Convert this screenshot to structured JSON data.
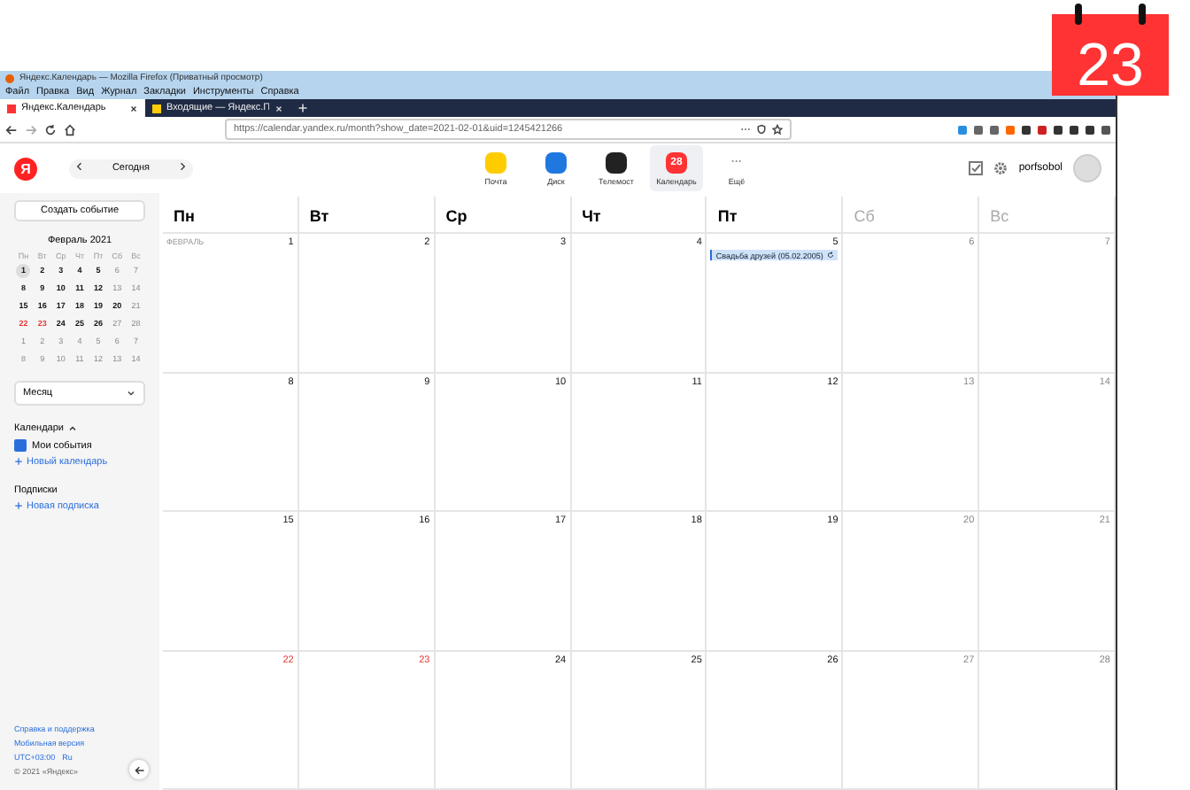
{
  "badge_day": "23",
  "browser": {
    "title": "Яндекс.Календарь — Mozilla Firefox (Приватный просмотр)",
    "menu": [
      "Файл",
      "Правка",
      "Вид",
      "Журнал",
      "Закладки",
      "Инструменты",
      "Справка"
    ],
    "tabs": [
      {
        "label": "Яндекс.Календарь",
        "selected": true
      },
      {
        "label": "Входящие — Яндекс.П",
        "selected": false
      }
    ],
    "url": "https://calendar.yandex.ru/month?show_date=2021-02-01&uid=1245421266"
  },
  "header": {
    "logo": "Я",
    "today_button": "Сегодня",
    "services": [
      {
        "label": "Почта",
        "kind": "mail",
        "selected": false
      },
      {
        "label": "Диск",
        "kind": "disk",
        "selected": false
      },
      {
        "label": "Телемост",
        "kind": "telemost",
        "selected": false
      },
      {
        "label": "Календарь",
        "kind": "calendar",
        "icon_text": "28",
        "selected": true
      },
      {
        "label": "Ещё",
        "kind": "more",
        "icon_text": "···",
        "selected": false
      }
    ],
    "user": "porfsobol"
  },
  "sidebar": {
    "create_button": "Создать событие",
    "mini_calendar": {
      "title": "Февраль 2021",
      "weekdays": [
        "Пн",
        "Вт",
        "Ср",
        "Чт",
        "Пт",
        "Сб",
        "Вс"
      ],
      "weeks": [
        [
          {
            "day": "1",
            "kind": "normal",
            "selected": true
          },
          {
            "day": "2",
            "kind": "normal",
            "selected": false
          },
          {
            "day": "3",
            "kind": "normal",
            "selected": false
          },
          {
            "day": "4",
            "kind": "normal",
            "selected": false
          },
          {
            "day": "5",
            "kind": "normal",
            "selected": false
          },
          {
            "day": "6",
            "kind": "weekend",
            "selected": false
          },
          {
            "day": "7",
            "kind": "weekend",
            "selected": false
          }
        ],
        [
          {
            "day": "8",
            "kind": "normal",
            "selected": false
          },
          {
            "day": "9",
            "kind": "normal",
            "selected": false
          },
          {
            "day": "10",
            "kind": "normal",
            "selected": false
          },
          {
            "day": "11",
            "kind": "normal",
            "selected": false
          },
          {
            "day": "12",
            "kind": "normal",
            "selected": false
          },
          {
            "day": "13",
            "kind": "weekend",
            "selected": false
          },
          {
            "day": "14",
            "kind": "weekend",
            "selected": false
          }
        ],
        [
          {
            "day": "15",
            "kind": "normal",
            "selected": false
          },
          {
            "day": "16",
            "kind": "normal",
            "selected": false
          },
          {
            "day": "17",
            "kind": "normal",
            "selected": false
          },
          {
            "day": "18",
            "kind": "normal",
            "selected": false
          },
          {
            "day": "19",
            "kind": "normal",
            "selected": false
          },
          {
            "day": "20",
            "kind": "normal",
            "selected": false
          },
          {
            "day": "21",
            "kind": "weekend",
            "selected": false
          }
        ],
        [
          {
            "day": "22",
            "kind": "holiday",
            "selected": false
          },
          {
            "day": "23",
            "kind": "holiday",
            "selected": false
          },
          {
            "day": "24",
            "kind": "normal",
            "selected": false
          },
          {
            "day": "25",
            "kind": "normal",
            "selected": false
          },
          {
            "day": "26",
            "kind": "normal",
            "selected": false
          },
          {
            "day": "27",
            "kind": "weekend",
            "selected": false
          },
          {
            "day": "28",
            "kind": "weekend",
            "selected": false
          }
        ],
        [
          {
            "day": "1",
            "kind": "other",
            "selected": false
          },
          {
            "day": "2",
            "kind": "other",
            "selected": false
          },
          {
            "day": "3",
            "kind": "other",
            "selected": false
          },
          {
            "day": "4",
            "kind": "other",
            "selected": false
          },
          {
            "day": "5",
            "kind": "other",
            "selected": false
          },
          {
            "day": "6",
            "kind": "other",
            "selected": false
          },
          {
            "day": "7",
            "kind": "other",
            "selected": false
          }
        ],
        [
          {
            "day": "8",
            "kind": "other",
            "selected": false
          },
          {
            "day": "9",
            "kind": "other",
            "selected": false
          },
          {
            "day": "10",
            "kind": "other",
            "selected": false
          },
          {
            "day": "11",
            "kind": "other",
            "selected": false
          },
          {
            "day": "12",
            "kind": "other",
            "selected": false
          },
          {
            "day": "13",
            "kind": "other",
            "selected": false
          },
          {
            "day": "14",
            "kind": "other",
            "selected": false
          }
        ]
      ]
    },
    "view_select": "Месяц",
    "calendars": {
      "title": "Календари",
      "items": [
        {
          "label": "Мои события",
          "checked": true
        }
      ],
      "add": "Новый календарь"
    },
    "subscriptions": {
      "title": "Подписки",
      "add": "Новая подписка"
    },
    "footer": [
      "Справка и поддержка",
      "Мобильная версия",
      "UTC+03:00",
      "Ru",
      "© 2021 «Яндекс»"
    ]
  },
  "grid": {
    "weekdays": [
      {
        "label": "Пн",
        "weekend": false
      },
      {
        "label": "Вт",
        "weekend": false
      },
      {
        "label": "Ср",
        "weekend": false
      },
      {
        "label": "Чт",
        "weekend": false
      },
      {
        "label": "Пт",
        "weekend": false
      },
      {
        "label": "Сб",
        "weekend": true
      },
      {
        "label": "Вс",
        "weekend": true
      }
    ],
    "month_label": "ФЕВРАЛЬ",
    "weeks": [
      [
        {
          "day": "1",
          "kind": "normal"
        },
        {
          "day": "2",
          "kind": "normal"
        },
        {
          "day": "3",
          "kind": "normal"
        },
        {
          "day": "4",
          "kind": "normal"
        },
        {
          "day": "5",
          "kind": "normal",
          "events": [
            {
              "title": "Свадьба друзей (05.02.2005)"
            }
          ]
        },
        {
          "day": "6",
          "kind": "weekend"
        },
        {
          "day": "7",
          "kind": "weekend"
        }
      ],
      [
        {
          "day": "8",
          "kind": "normal"
        },
        {
          "day": "9",
          "kind": "normal"
        },
        {
          "day": "10",
          "kind": "normal"
        },
        {
          "day": "11",
          "kind": "normal"
        },
        {
          "day": "12",
          "kind": "normal"
        },
        {
          "day": "13",
          "kind": "weekend"
        },
        {
          "day": "14",
          "kind": "weekend"
        }
      ],
      [
        {
          "day": "15",
          "kind": "normal"
        },
        {
          "day": "16",
          "kind": "normal"
        },
        {
          "day": "17",
          "kind": "normal"
        },
        {
          "day": "18",
          "kind": "normal"
        },
        {
          "day": "19",
          "kind": "normal"
        },
        {
          "day": "20",
          "kind": "weekend"
        },
        {
          "day": "21",
          "kind": "weekend"
        }
      ],
      [
        {
          "day": "22",
          "kind": "holiday"
        },
        {
          "day": "23",
          "kind": "holiday"
        },
        {
          "day": "24",
          "kind": "normal"
        },
        {
          "day": "25",
          "kind": "normal"
        },
        {
          "day": "26",
          "kind": "normal"
        },
        {
          "day": "27",
          "kind": "weekend"
        },
        {
          "day": "28",
          "kind": "weekend"
        }
      ]
    ]
  }
}
